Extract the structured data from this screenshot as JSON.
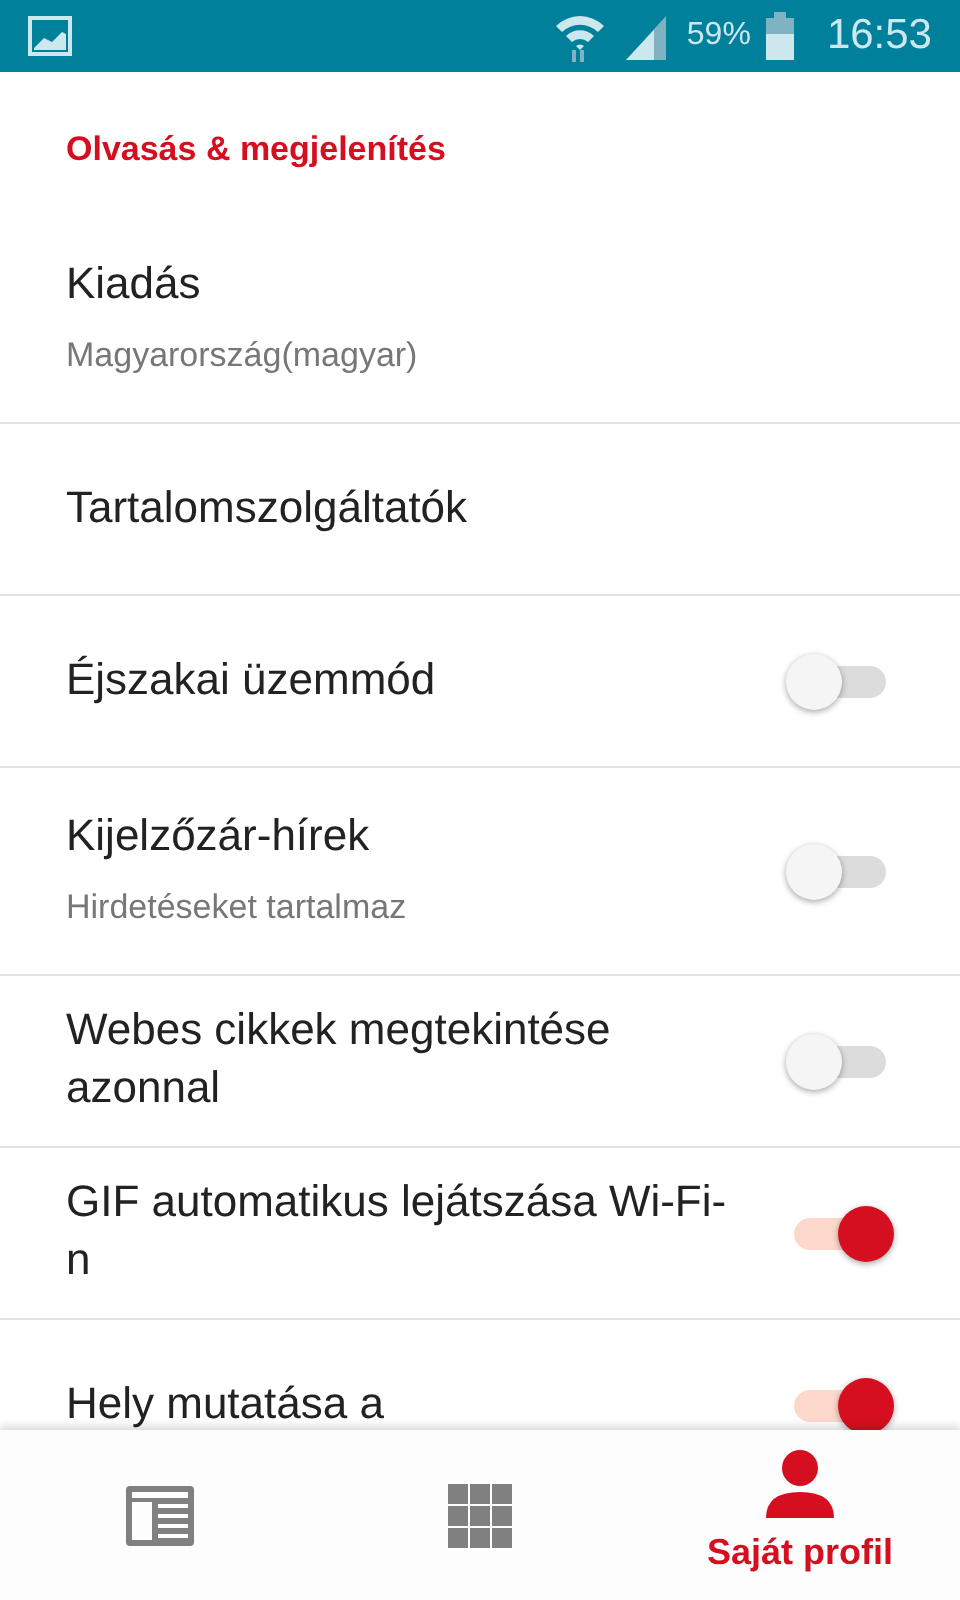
{
  "status_bar": {
    "battery_text": "59%",
    "time": "16:53"
  },
  "section": {
    "title": "Olvasás & megjelenítés"
  },
  "items": [
    {
      "kind": "nav",
      "title": "Kiadás",
      "subtitle": "Magyarország(magyar)"
    },
    {
      "kind": "nav",
      "title": "Tartalomszolgáltatók"
    },
    {
      "kind": "toggle",
      "title": "Éjszakai üzemmód",
      "on": false
    },
    {
      "kind": "toggle",
      "title": "Kijelzőzár-hírek",
      "subtitle": "Hirdetéseket tartalmaz",
      "on": false
    },
    {
      "kind": "toggle",
      "title": "Webes cikkek megtekintése azonnal",
      "on": false
    },
    {
      "kind": "toggle",
      "title": "GIF automatikus lejátszása Wi-Fi-n",
      "on": true
    },
    {
      "kind": "toggle",
      "title": "Hely mutatása a",
      "on": true
    }
  ],
  "bottom_nav": [
    {
      "kind": "news",
      "selected": false
    },
    {
      "kind": "grid",
      "selected": false
    },
    {
      "kind": "person",
      "label": "Saját profil",
      "selected": true
    }
  ]
}
